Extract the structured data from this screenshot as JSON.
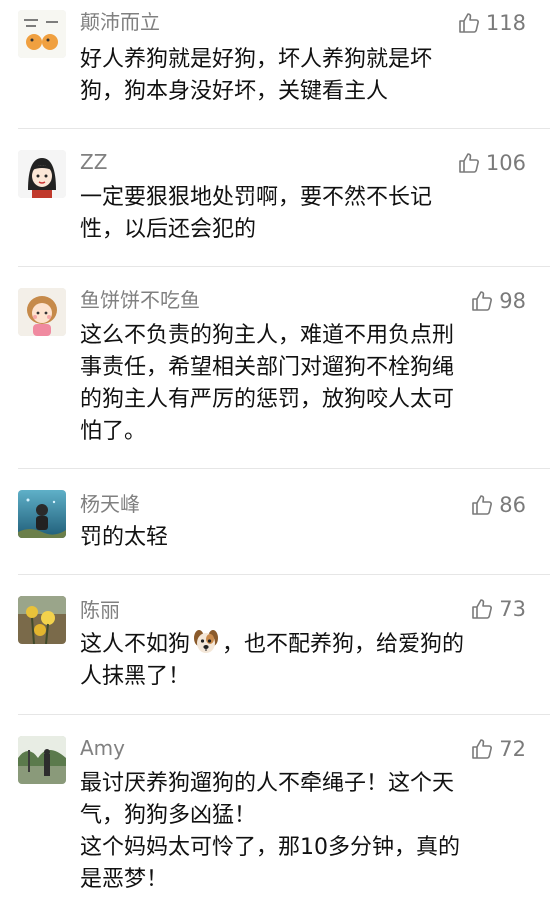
{
  "comments": [
    {
      "username": "颠沛而立",
      "likes": "118",
      "lines": [
        "好人养狗就是好狗，坏人养狗就是坏",
        "狗，狗本身没好坏，关键看主人"
      ],
      "avatar_icon": "cartoon-avatar-icon"
    },
    {
      "username": "ZZ",
      "likes": "106",
      "lines": [
        "一定要狠狠地处罚啊，要不然不长记",
        "性，以后还会犯的"
      ],
      "avatar_icon": "cartoon-girl-avatar-icon"
    },
    {
      "username": "鱼饼饼不吃鱼",
      "likes": "98",
      "lines": [
        "这么不负责的狗主人，难道不用负点刑",
        "事责任，希望相关部门对遛狗不栓狗绳",
        "的狗主人有严厉的惩罚，放狗咬人太可",
        "怕了。"
      ],
      "avatar_icon": "cartoon-girl-avatar-icon"
    },
    {
      "username": "杨天峰",
      "likes": "86",
      "lines": [
        "罚的太轻"
      ],
      "avatar_icon": "diver-photo-avatar-icon"
    },
    {
      "username": "陈丽",
      "likes": "73",
      "lines_html": true,
      "line1_before": "这人不如狗",
      "line1_after": "，也不配养狗，给爱狗的",
      "line2": "人抹黑了！",
      "emoji": "dog-face-emoji-icon",
      "avatar_icon": "flower-photo-avatar-icon"
    },
    {
      "username": "Amy",
      "likes": "72",
      "lines": [
        "最讨厌养狗遛狗的人不牵绳子！这个天",
        "气，狗狗多凶猛！",
        "这个妈妈太可怜了，那10多分钟，真的",
        "是恶梦！"
      ],
      "avatar_icon": "park-photo-avatar-icon"
    }
  ],
  "colors": {
    "username": "#808080",
    "text": "#111111",
    "like": "#7a7a7a",
    "divider": "#e6e6e6"
  }
}
